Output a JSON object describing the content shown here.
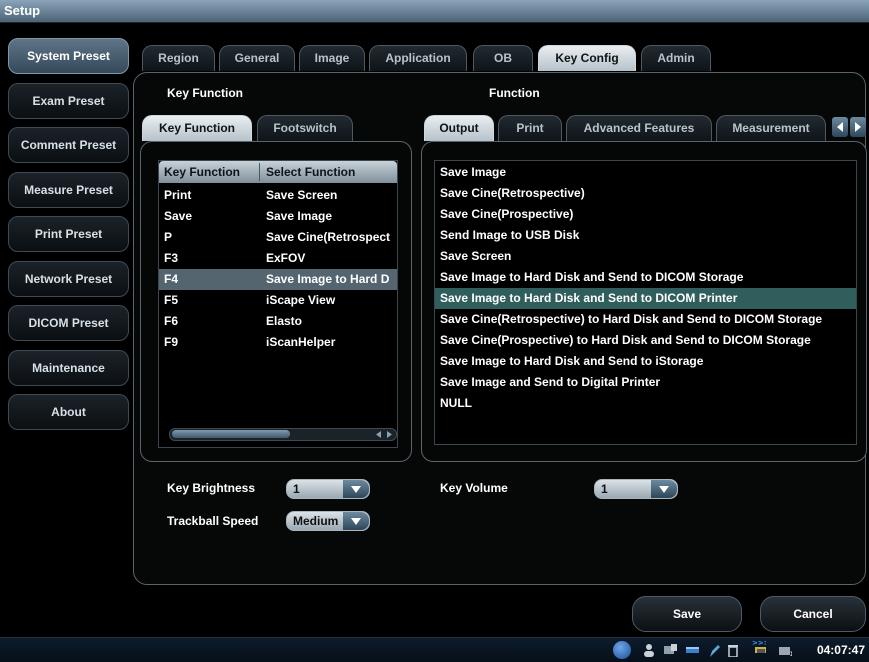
{
  "window": {
    "title": "Setup"
  },
  "presets": [
    "System Preset",
    "Exam Preset",
    "Comment Preset",
    "Measure Preset",
    "Print Preset",
    "Network Preset",
    "DICOM Preset",
    "Maintenance",
    "About"
  ],
  "top_tabs": [
    "Region",
    "General",
    "Image",
    "Application",
    "OB",
    "Key Config",
    "Admin"
  ],
  "key_function_label": "Key Function",
  "function_label": "Function",
  "left_tabs": [
    "Key Function",
    "Footswitch"
  ],
  "right_tabs": [
    "Output",
    "Print",
    "Advanced Features",
    "Measurement"
  ],
  "key_table": {
    "headers": [
      "Key Function",
      "Select Function"
    ],
    "rows": [
      [
        "Print",
        "Save Screen"
      ],
      [
        "Save",
        "Save Image"
      ],
      [
        "P",
        "Save Cine(Retrospect"
      ],
      [
        "F3",
        "ExFOV"
      ],
      [
        "F4",
        "Save Image to Hard D"
      ],
      [
        "F5",
        "iScape View"
      ],
      [
        "F6",
        "Elasto"
      ],
      [
        "F9",
        "iScanHelper"
      ]
    ],
    "selected_row": 4
  },
  "functions": [
    "Save Image",
    "Save Cine(Retrospective)",
    "Save Cine(Prospective)",
    "Send Image to USB Disk",
    "Save Screen",
    "Save Image to Hard Disk and Send to DICOM Storage",
    "Save Image to Hard Disk and Send to DICOM Printer",
    "Save Cine(Retrospective) to Hard Disk and Send to DICOM Storage",
    "Save Cine(Prospective)  to Hard Disk and Send to DICOM Storage",
    "Save Image to Hard Disk and Send to iStorage",
    "Save Image and Send to Digital Printer",
    "NULL"
  ],
  "functions_selected": 6,
  "settings": {
    "key_brightness_label": "Key Brightness",
    "key_brightness_value": "1",
    "trackball_speed_label": "Trackball Speed",
    "trackball_speed_value": "Medium",
    "key_volume_label": "Key Volume",
    "key_volume_value": "1"
  },
  "buttons": {
    "save": "Save",
    "cancel": "Cancel"
  },
  "taskbar": {
    "time": "04:07:47"
  }
}
